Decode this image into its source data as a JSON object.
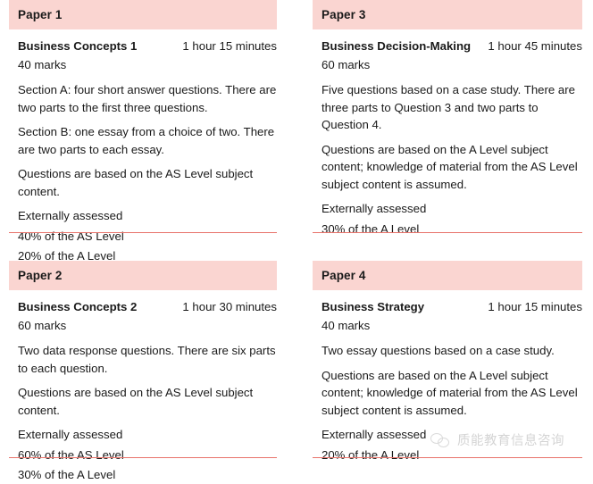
{
  "document": {
    "type": "syllabus-assessment-overview",
    "watermark": {
      "text": "质能教育信息咨询",
      "icon": "wechat-icon"
    },
    "colors": {
      "header_background": "#fad5d1",
      "divider": "#e8736b",
      "text": "#1a1a1a",
      "page_background": "#ffffff"
    }
  },
  "papers": [
    {
      "header": "Paper 1",
      "name": "Business Concepts 1",
      "duration": "1 hour 15 minutes",
      "marks": "40 marks",
      "details": [
        "Section A: four short answer questions. There are two parts to the first three questions.",
        "Section B: one essay from a choice of two. There are two parts to each essay.",
        "Questions are based on the AS Level subject content."
      ],
      "assessment": "Externally assessed",
      "weightings": [
        "40% of the AS Level",
        "20% of the A Level"
      ]
    },
    {
      "header": "Paper 3",
      "name": "Business Decision-Making",
      "duration": "1 hour 45 minutes",
      "marks": "60 marks",
      "details": [
        "Five questions based on a case study. There are three parts to Question 3 and two parts to Question 4.",
        "Questions are based on the A Level subject content; knowledge of material from the AS Level subject content is assumed."
      ],
      "assessment": "Externally assessed",
      "weightings": [
        "30% of the A Level"
      ]
    },
    {
      "header": "Paper 2",
      "name": "Business Concepts 2",
      "duration": "1 hour 30 minutes",
      "marks": "60 marks",
      "details": [
        "Two data response questions. There are six parts to each question.",
        "Questions are based on the AS Level subject content."
      ],
      "assessment": "Externally assessed",
      "weightings": [
        "60% of the AS Level",
        "30% of the A Level"
      ]
    },
    {
      "header": "Paper 4",
      "name": "Business Strategy",
      "duration": "1 hour 15 minutes",
      "marks": "40 marks",
      "details": [
        "Two essay questions based on a case study.",
        "Questions are based on the A Level subject content; knowledge of material from the AS Level subject content is assumed."
      ],
      "assessment": "Externally assessed",
      "weightings": [
        "20% of the A Level"
      ]
    }
  ]
}
